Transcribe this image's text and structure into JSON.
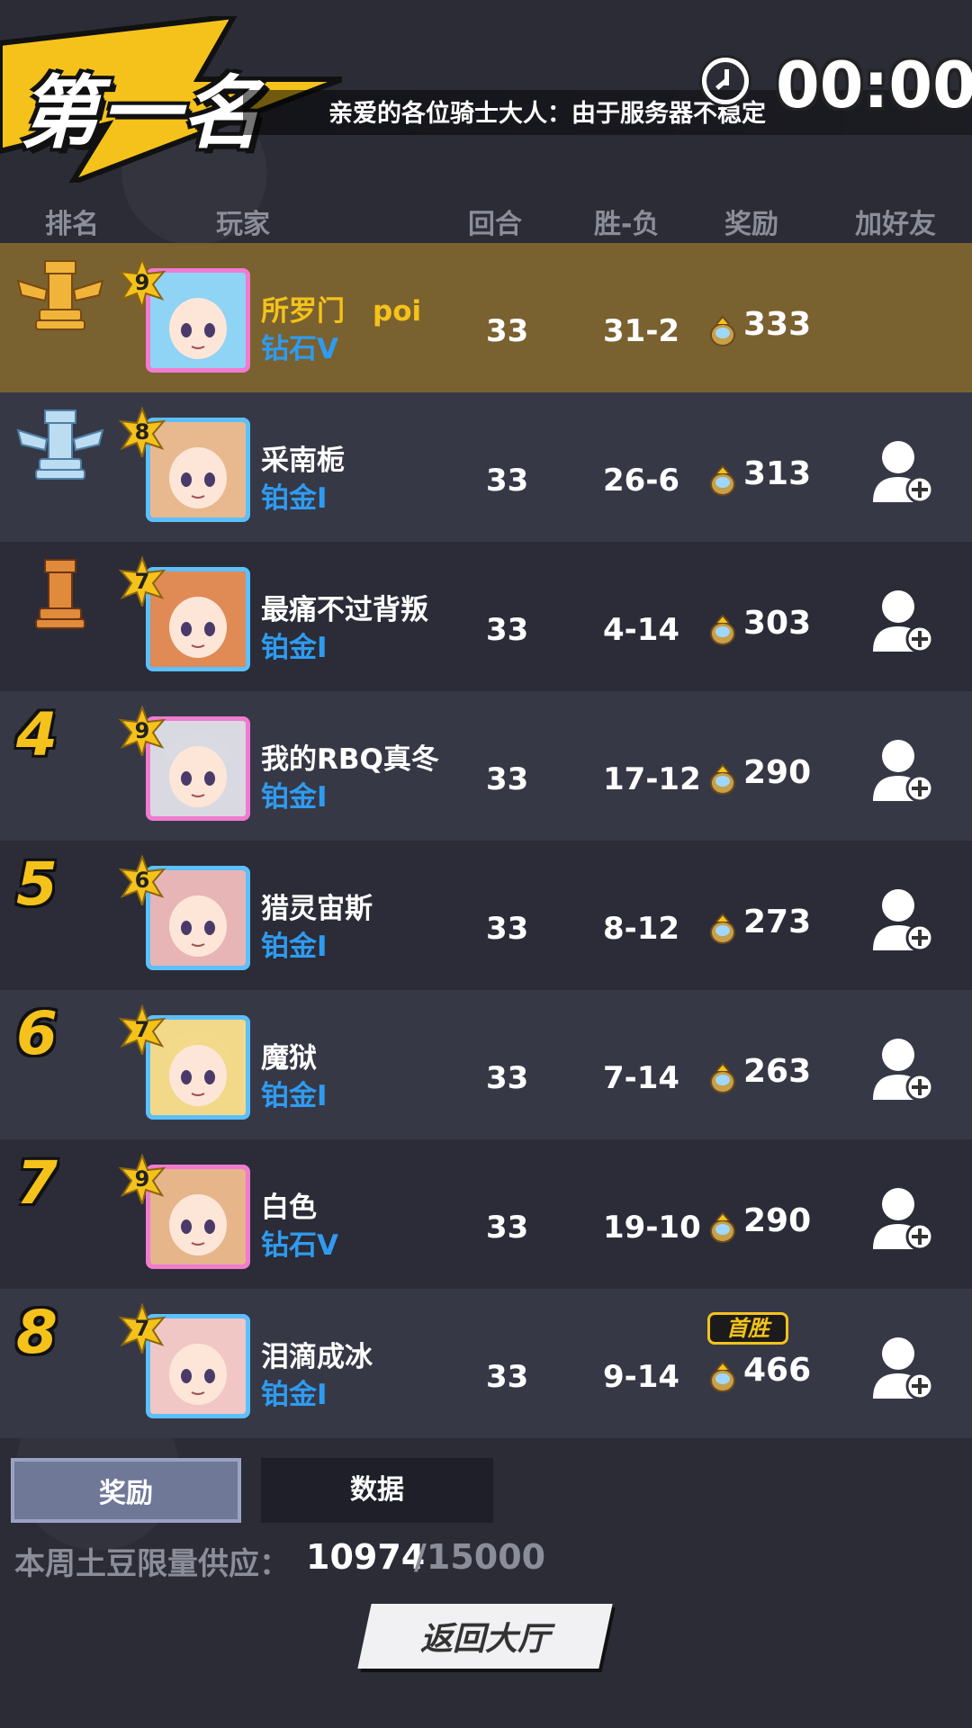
{
  "header": {
    "rank_title": "第一名",
    "notice": "亲爱的各位骑士大人：由于服务器不稳定",
    "timer": "00:00"
  },
  "columns": [
    "排名",
    "玩家",
    "回合",
    "胜-负",
    "奖励",
    "加好友"
  ],
  "rows": [
    {
      "rank": "1",
      "rank_icon": "gold-rook-icon",
      "level": "9",
      "name": "所罗门　poi",
      "tier": "钻石V",
      "rounds": "33",
      "wl": "31-2",
      "reward": "333",
      "avatar_color": "#8fd3f5",
      "add_friend": false
    },
    {
      "rank": "2",
      "rank_icon": "silver-rook-icon",
      "level": "8",
      "name": "采南栀",
      "tier": "铂金I",
      "rounds": "33",
      "wl": "26-6",
      "reward": "313",
      "avatar_color": "#e8b98f",
      "add_friend": true
    },
    {
      "rank": "3",
      "rank_icon": "bronze-rook-icon",
      "level": "7",
      "name": "最痛不过背叛",
      "tier": "铂金I",
      "rounds": "33",
      "wl": "4-14",
      "reward": "303",
      "avatar_color": "#e08a55",
      "add_friend": true
    },
    {
      "rank": "4",
      "level": "9",
      "name": "我的RBQ真冬",
      "tier": "铂金I",
      "rounds": "33",
      "wl": "17-12",
      "reward": "290",
      "avatar_color": "#d9d9e2",
      "add_friend": true
    },
    {
      "rank": "5",
      "level": "6",
      "name": "猎灵宙斯",
      "tier": "铂金I",
      "rounds": "33",
      "wl": "8-12",
      "reward": "273",
      "avatar_color": "#e7b5b5",
      "add_friend": true
    },
    {
      "rank": "6",
      "level": "7",
      "name": "魔狱",
      "tier": "铂金I",
      "rounds": "33",
      "wl": "7-14",
      "reward": "263",
      "avatar_color": "#f2d98a",
      "add_friend": true
    },
    {
      "rank": "7",
      "level": "9",
      "name": "白色",
      "tier": "钻石V",
      "rounds": "33",
      "wl": "19-10",
      "reward": "290",
      "avatar_color": "#e6b58a",
      "add_friend": true
    },
    {
      "rank": "8",
      "level": "7",
      "name": "泪滴成冰",
      "tier": "铂金I",
      "rounds": "33",
      "wl": "9-14",
      "reward": "466",
      "avatar_color": "#f0c7c4",
      "add_friend": true,
      "badge": "首胜"
    }
  ],
  "tabs": {
    "reward": "奖励",
    "data": "数据"
  },
  "supply": {
    "label": "本周土豆限量供应：",
    "current": "10974",
    "max": "/15000"
  },
  "back_button": "返回大厅",
  "colors": {
    "gold": "#f4c21b",
    "tier_blue": "#2f9bf0",
    "first_row": "#7a6130"
  }
}
